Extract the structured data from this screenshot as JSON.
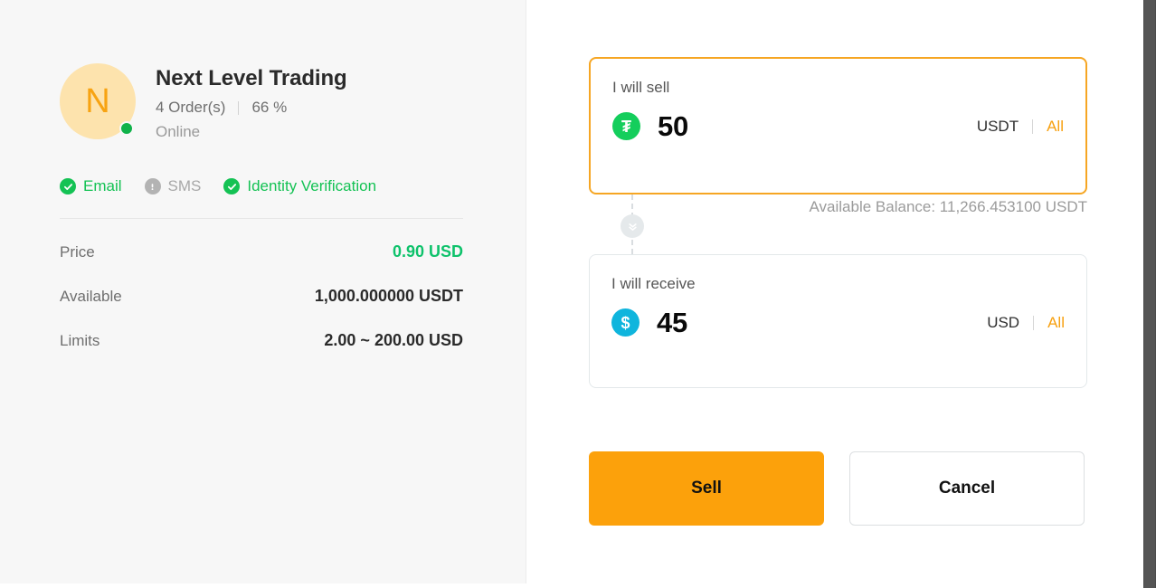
{
  "merchant": {
    "avatar_initial": "N",
    "name": "Next Level Trading",
    "orders": "4 Order(s)",
    "completion_rate": "66 %",
    "status": "Online",
    "verifications": [
      {
        "label": "Email",
        "state": "verified",
        "icon": "check-circle-icon"
      },
      {
        "label": "SMS",
        "state": "unverified",
        "icon": "exclamation-circle-icon"
      },
      {
        "label": "Identity Verification",
        "state": "verified",
        "icon": "check-circle-icon"
      }
    ],
    "details": [
      {
        "label": "Price",
        "value": "0.90 USD",
        "highlight": "price"
      },
      {
        "label": "Available",
        "value": "1,000.000000 USDT",
        "highlight": "none"
      },
      {
        "label": "Limits",
        "value": "2.00 ~ 200.00 USD",
        "highlight": "none"
      }
    ]
  },
  "form": {
    "sell": {
      "label": "I will sell",
      "amount": "50",
      "currency": "USDT",
      "all_label": "All",
      "coin_glyph": "₮",
      "coin_icon": "usdt-coin-icon"
    },
    "available_balance": "Available Balance: 11,266.453100 USDT",
    "swap_icon": "double-chevron-down-icon",
    "receive": {
      "label": "I will receive",
      "amount": "45",
      "currency": "USD",
      "all_label": "All",
      "coin_glyph": "$",
      "coin_icon": "usd-coin-icon"
    },
    "submit_label": "Sell",
    "cancel_label": "Cancel"
  },
  "colors": {
    "accent_orange": "#fca10b",
    "border_orange": "#f6a623",
    "green": "#14c254",
    "price_green": "#0ec26b",
    "usdt_green": "#14ce5c",
    "usd_blue": "#0fb5dd",
    "avatar_bg": "#fde3ad",
    "avatar_fg": "#f7a312",
    "panel_bg": "#f7f7f7",
    "muted_text": "#9a9a9a"
  }
}
